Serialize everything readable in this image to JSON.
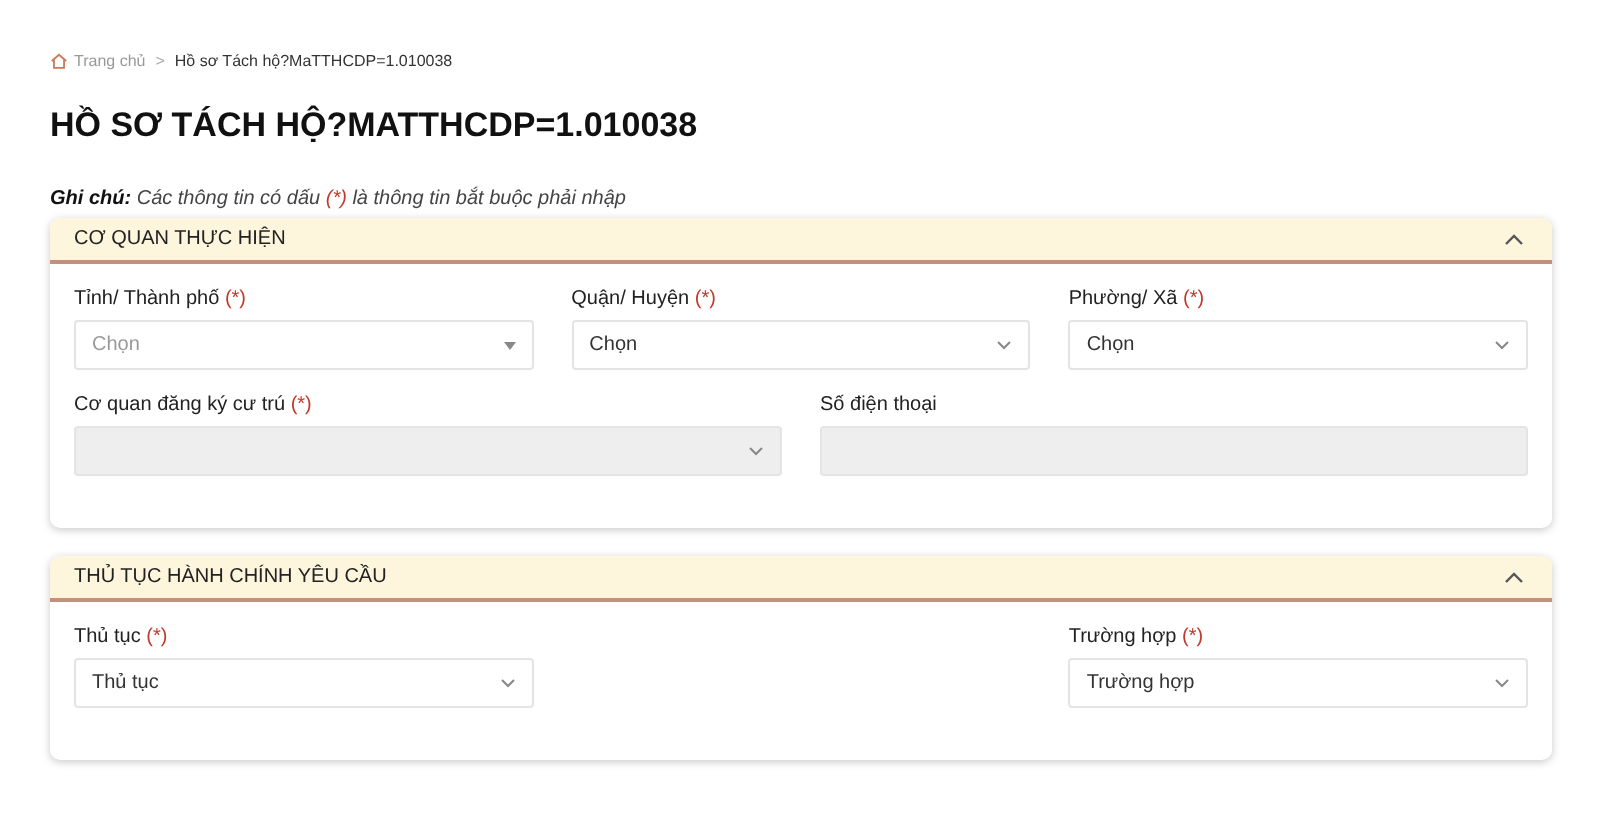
{
  "breadcrumb": [
    {
      "label": "Trang chủ",
      "kind": "home"
    },
    {
      "label": "Hồ sơ Tách hộ?MaTTHCDP=1.010038",
      "kind": "page",
      "separator": ">"
    }
  ],
  "title": "HỒ SƠ TÁCH HỘ?MATTHCDP=1.010038",
  "note": {
    "label": "Ghi chú:",
    "text": "Các thông tin có dấu",
    "mark": "(*)",
    "rest": "là thông tin bắt buộc phải nhập"
  },
  "sections": [
    {
      "title": "CƠ QUAN THỰC HIỆN",
      "expanded": true,
      "rows": [
        {
          "kind": "thirds",
          "fields": [
            {
              "label": "Tỉnh/ Thành phố",
              "required": "(*)",
              "kind": "combo",
              "placeholder": "Chọn",
              "disabled": false
            },
            {
              "label": "Quận/ Huyện",
              "required": "(*)",
              "kind": "select",
              "value": "Chọn",
              "disabled": false
            },
            {
              "label": "Phường/ Xã",
              "required": "(*)",
              "kind": "select",
              "value": "Chọn",
              "disabled": false
            }
          ]
        },
        {
          "kind": "halves",
          "fields": [
            {
              "label": "Cơ quan đăng ký cư trú",
              "required": "(*)",
              "kind": "select",
              "disabled": true
            },
            {
              "label": "Số điện thoại",
              "kind": "text",
              "disabled": true
            }
          ]
        }
      ]
    },
    {
      "title": "THỦ TỤC HÀNH CHÍNH YÊU CẦU",
      "expanded": true,
      "rows": [
        {
          "kind": "thirds",
          "fields": [
            {
              "label": "Thủ tục",
              "required": "(*)",
              "kind": "select",
              "value": "Thủ tục",
              "disabled": false
            },
            {
              "label": "Trường hợp",
              "required": "(*)",
              "kind": "select",
              "value": "Trường hợp",
              "disabled": false
            }
          ]
        }
      ]
    }
  ]
}
